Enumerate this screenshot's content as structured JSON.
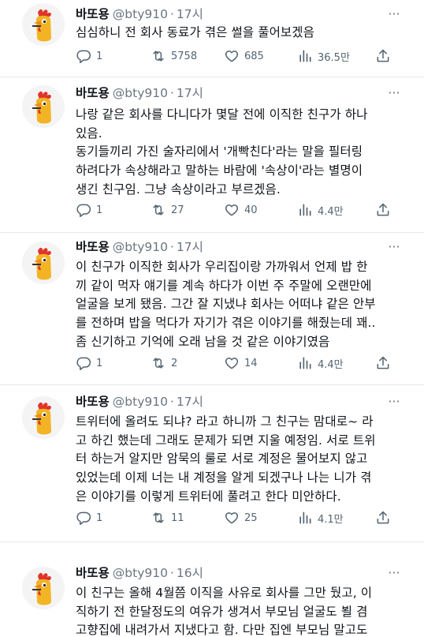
{
  "tweets": [
    {
      "name": "바또용",
      "handle": "@bty910",
      "time": "17시",
      "lines": [
        "심심하니 전 회사 동료가 겪은 썰을 풀어보겠음"
      ],
      "replies": "1",
      "retweets": "5758",
      "likes": "685",
      "views": "36.5만"
    },
    {
      "name": "바또용",
      "handle": "@bty910",
      "time": "17시",
      "lines": [
        "나랑 같은 회사를 다니다가 몇달 전에 이직한 친구가 하나",
        "있음.",
        "동기들끼리 가진 술자리에서 '개빡친다'라는 말을 필터링",
        "하려다가 속상해라고 말하는 바람에 '속상이'라는 별명이",
        "생긴 친구임. 그냥 속상이라고 부르겠음."
      ],
      "replies": "1",
      "retweets": "27",
      "likes": "40",
      "views": "4.4만"
    },
    {
      "name": "바또용",
      "handle": "@bty910",
      "time": "17시",
      "lines": [
        "이 친구가 이직한 회사가 우리집이랑 가까워서 언제 밥 한",
        "끼 같이 먹자 얘기를 계속 하다가 이번 주 주말에 오랜만에",
        "얼굴을 보게 됐음. 그간 잘 지냈냐 회사는 어떠냐 같은 안부",
        "를 전하며 밥을 먹다가 자기가 겪은 이야기를 해줬는데 꽤..",
        "좀 신기하고 기억에 오래 남을 것 같은 이야기였음"
      ],
      "replies": "1",
      "retweets": "2",
      "likes": "14",
      "views": "4.4만"
    },
    {
      "name": "바또용",
      "handle": "@bty910",
      "time": "17시",
      "lines": [
        "트위터에 올려도 되냐? 라고 하니까 그 친구는 맘대로~ 라",
        "고 하긴 했는데 그래도 문제가 되면 지울 예정임. 서로 트위",
        "터 하는거 알지만 암묵의 룰로 서로 계정은 물어보지 않고",
        "있었는데 이제 너는 내 계정을 알게 되겠구나 나는 니가 겪",
        "은 이야기를 이렇게 트위터에 풀려고 한다 미안하다."
      ],
      "replies": "1",
      "retweets": "11",
      "likes": "25",
      "views": "4.1만"
    },
    {
      "name": "바또용",
      "handle": "@bty910",
      "time": "16시",
      "lines": [
        "이 친구는 올해 4월쯤 이직을 사유로 회사를 그만 뒀고, 이",
        "직하기 전 한달정도의 여유가 생겨서 부모님 얼굴도 뵐 겸",
        "고향집에 내려가서 지냈다고 함. 다만 집엔 부모님 말고도"
      ]
    }
  ]
}
